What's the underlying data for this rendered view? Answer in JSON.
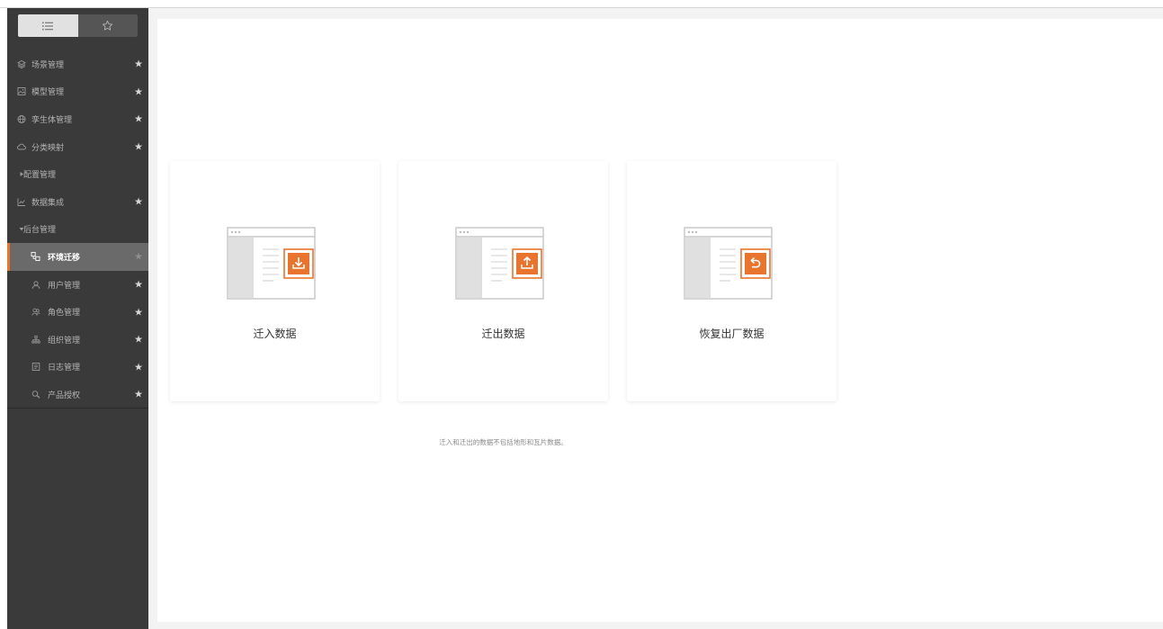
{
  "sidebar": {
    "toggle": {
      "list_icon": "list-icon",
      "favorites_icon": "star-outline-icon"
    },
    "items": [
      {
        "label": "场景管理",
        "icon": "layers-icon",
        "star": "★"
      },
      {
        "label": "模型管理",
        "icon": "image-icon",
        "star": "★"
      },
      {
        "label": "孪生体管理",
        "icon": "globe-icon",
        "star": "★"
      },
      {
        "label": "分类映射",
        "icon": "cloud-icon",
        "star": "★"
      },
      {
        "label": "配置管理",
        "icon": "caret-right-icon"
      },
      {
        "label": "数据集成",
        "icon": "line-chart-icon",
        "star": "★"
      },
      {
        "label": "后台管理",
        "icon": "caret-down-icon"
      },
      {
        "label": "环境迁移",
        "icon": "migrate-icon",
        "star": "★",
        "active": true
      },
      {
        "label": "用户管理",
        "icon": "user-icon",
        "star": "★"
      },
      {
        "label": "角色管理",
        "icon": "users-icon",
        "star": "★"
      },
      {
        "label": "组织管理",
        "icon": "org-icon",
        "star": "★"
      },
      {
        "label": "日志管理",
        "icon": "log-icon",
        "star": "★"
      },
      {
        "label": "产品授权",
        "icon": "key-icon",
        "star": "★"
      }
    ]
  },
  "main": {
    "cards": [
      {
        "label": "迁入数据",
        "icon": "import-icon"
      },
      {
        "label": "迁出数据",
        "icon": "export-icon"
      },
      {
        "label": "恢复出厂数据",
        "icon": "restore-icon"
      }
    ],
    "note": "迁入和迁出的数据不包括地形和瓦片数据。"
  },
  "colors": {
    "sidebar_bg": "#3a3a3a",
    "active_item_bg": "#6a6a6a",
    "accent": "#e8742e"
  }
}
